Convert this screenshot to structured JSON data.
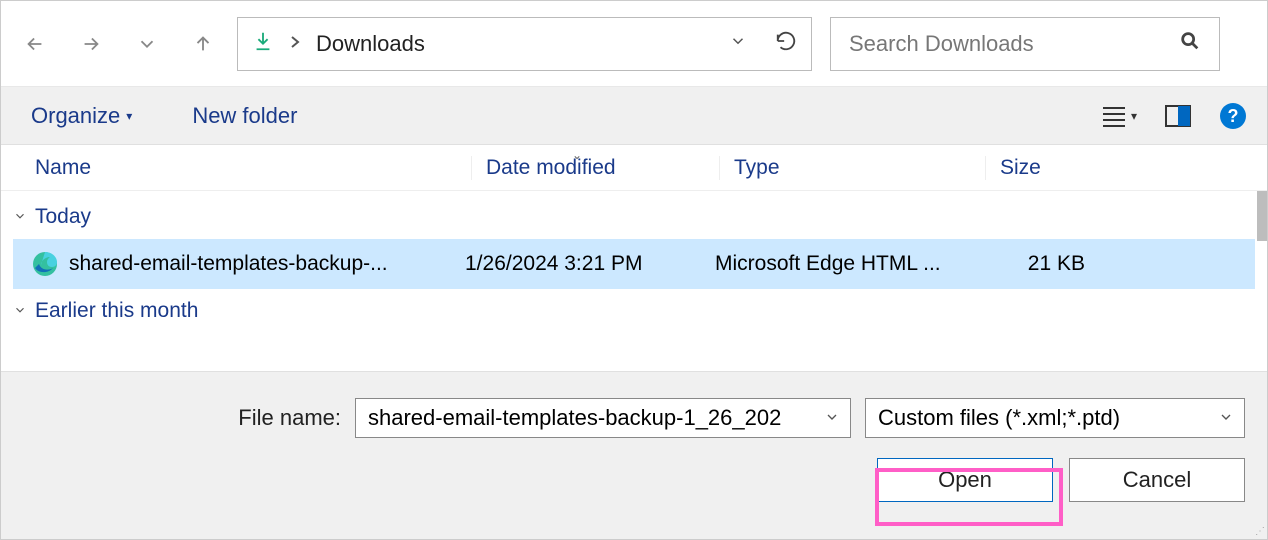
{
  "nav": {
    "location": "Downloads"
  },
  "search": {
    "placeholder": "Search Downloads"
  },
  "toolbar": {
    "organize": "Organize",
    "newfolder": "New folder"
  },
  "columns": {
    "name": "Name",
    "date": "Date modified",
    "type": "Type",
    "size": "Size"
  },
  "groups": {
    "today": "Today",
    "earlier": "Earlier this month"
  },
  "files": [
    {
      "name": "shared-email-templates-backup-...",
      "date": "1/26/2024 3:21 PM",
      "type": "Microsoft Edge HTML ...",
      "size": "21 KB"
    }
  ],
  "bottom": {
    "filename_label": "File name:",
    "filename_value": "shared-email-templates-backup-1_26_202",
    "filter": "Custom files (*.xml;*.ptd)",
    "open": "Open",
    "cancel": "Cancel"
  }
}
